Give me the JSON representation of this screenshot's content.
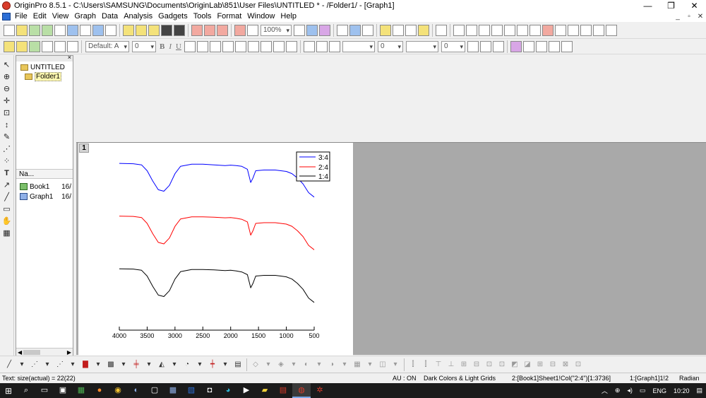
{
  "titlebar": {
    "title": "OriginPro 8.5.1 - C:\\Users\\SAMSUNG\\Documents\\OriginLab\\851\\User Files\\UNTITLED * - /Folder1/ - [Graph1]",
    "minimize": "—",
    "restore": "❐",
    "close": "✕"
  },
  "menubar": {
    "items": [
      "File",
      "Edit",
      "View",
      "Graph",
      "Data",
      "Analysis",
      "Gadgets",
      "Tools",
      "Format",
      "Window",
      "Help"
    ],
    "mdi_minimize": "_",
    "mdi_restore": "▫",
    "mdi_close": "✕"
  },
  "toolbar": {
    "zoom": "100%",
    "font": "Default: A",
    "font_size": "0",
    "bold": "B",
    "italic": "I",
    "underline": "U",
    "line_size": "0",
    "pattern_size": "0",
    "symbol_size": "0"
  },
  "explorer": {
    "root": "UNTITLED",
    "folder": "Folder1",
    "column_name": "Na...",
    "items": [
      {
        "name": "Book1",
        "rest": "16/"
      },
      {
        "name": "Graph1",
        "rest": "16/"
      }
    ]
  },
  "graph": {
    "layer": "1",
    "legend": [
      {
        "label": "3:4",
        "color": "#0000ff"
      },
      {
        "label": "2:4",
        "color": "#ff0000"
      },
      {
        "label": "1:4",
        "color": "#000000"
      }
    ]
  },
  "chart_data": {
    "type": "line",
    "title": "",
    "xlabel": "",
    "ylabel": "",
    "xlim": [
      4000,
      500
    ],
    "x_reversed": true,
    "xticks": [
      4000,
      3500,
      3000,
      2500,
      2000,
      1500,
      1000,
      500
    ],
    "y_axis_visible": false,
    "series": [
      {
        "name": "3:4",
        "color": "#0000ff",
        "x": [
          4000,
          3750,
          3600,
          3500,
          3400,
          3300,
          3200,
          3100,
          3000,
          2900,
          2700,
          2500,
          2300,
          2100,
          2000,
          1900,
          1800,
          1700,
          1640,
          1600,
          1550,
          1400,
          1200,
          1100,
          1000,
          900,
          800,
          700,
          600,
          500
        ],
        "y": [
          0.98,
          0.978,
          0.97,
          0.93,
          0.86,
          0.8,
          0.79,
          0.83,
          0.91,
          0.96,
          0.975,
          0.975,
          0.97,
          0.965,
          0.968,
          0.965,
          0.96,
          0.94,
          0.85,
          0.88,
          0.93,
          0.935,
          0.935,
          0.93,
          0.925,
          0.91,
          0.88,
          0.84,
          0.78,
          0.75
        ]
      },
      {
        "name": "2:4",
        "color": "#ff0000",
        "x": [
          4000,
          3750,
          3600,
          3500,
          3400,
          3300,
          3200,
          3100,
          3000,
          2900,
          2700,
          2500,
          2300,
          2100,
          2000,
          1900,
          1800,
          1700,
          1640,
          1600,
          1550,
          1400,
          1200,
          1100,
          1000,
          900,
          800,
          700,
          600,
          500
        ],
        "y": [
          0.62,
          0.618,
          0.61,
          0.57,
          0.5,
          0.44,
          0.43,
          0.47,
          0.55,
          0.6,
          0.615,
          0.615,
          0.612,
          0.608,
          0.61,
          0.605,
          0.598,
          0.58,
          0.49,
          0.52,
          0.57,
          0.575,
          0.575,
          0.57,
          0.565,
          0.55,
          0.52,
          0.48,
          0.42,
          0.39
        ]
      },
      {
        "name": "1:4",
        "color": "#000000",
        "x": [
          4000,
          3750,
          3600,
          3500,
          3400,
          3300,
          3200,
          3100,
          3000,
          2900,
          2700,
          2500,
          2300,
          2100,
          2000,
          1900,
          1800,
          1700,
          1640,
          1600,
          1550,
          1400,
          1200,
          1100,
          1000,
          900,
          800,
          700,
          600,
          500
        ],
        "y": [
          0.26,
          0.258,
          0.25,
          0.21,
          0.14,
          0.08,
          0.07,
          0.11,
          0.19,
          0.24,
          0.255,
          0.255,
          0.252,
          0.248,
          0.25,
          0.245,
          0.238,
          0.22,
          0.13,
          0.16,
          0.21,
          0.215,
          0.215,
          0.21,
          0.205,
          0.19,
          0.16,
          0.12,
          0.06,
          0.03
        ]
      }
    ]
  },
  "statusbar": {
    "text": "Text: size(actual) = 22(22)",
    "au": "AU : ON",
    "theme": "Dark Colors & Light Grids",
    "column": "2:[Book1]Sheet1!Col(\"2:4\")[1:3736]",
    "layer": "1:[Graph1]1!2",
    "angle": "Radian"
  },
  "taskbar": {
    "lang": "ENG",
    "time": "10:20"
  }
}
